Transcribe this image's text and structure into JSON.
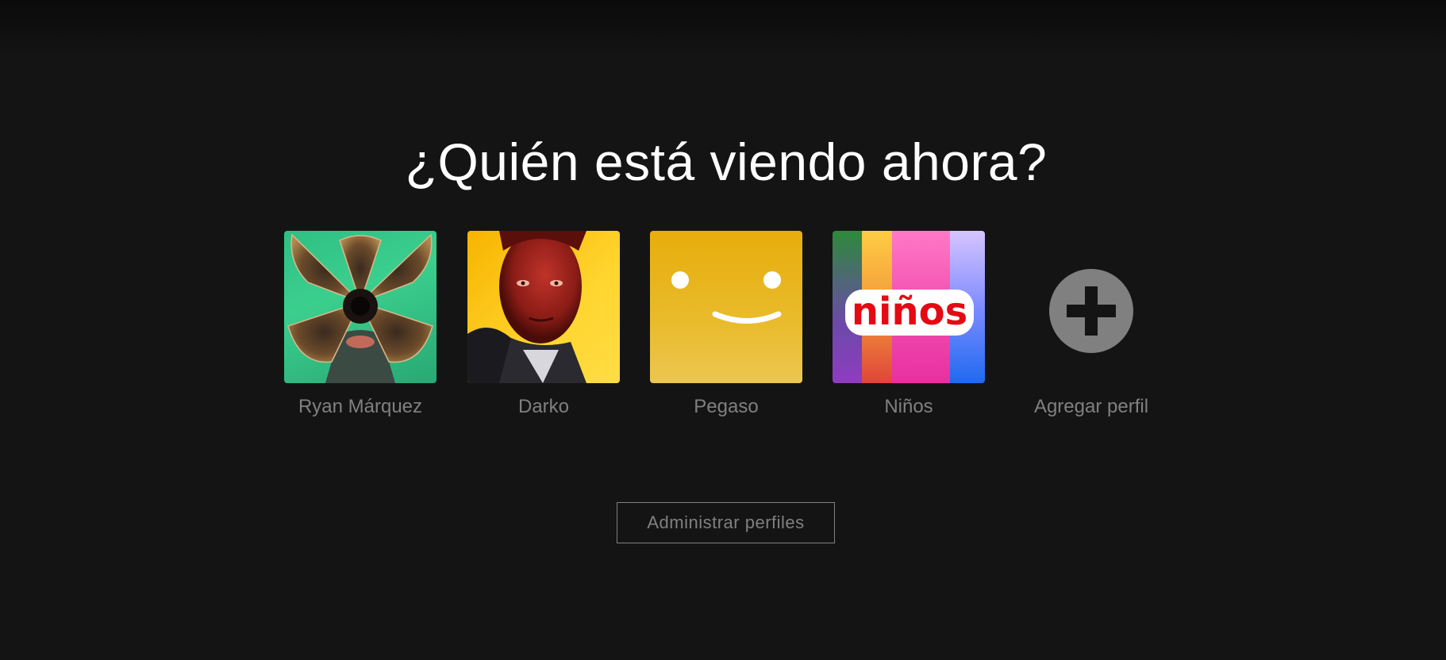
{
  "page": {
    "heading": "¿Quién está viendo ahora?"
  },
  "profiles": [
    {
      "name": "Ryan Márquez",
      "avatar": "creature-avatar"
    },
    {
      "name": "Darko",
      "avatar": "red-face-avatar"
    },
    {
      "name": "Pegaso",
      "avatar": "smiley-avatar"
    },
    {
      "name": "Niños",
      "avatar": "kids-avatar",
      "avatar_text": "niños"
    },
    {
      "name": "Agregar perfil",
      "avatar": "add-icon"
    }
  ],
  "manage": {
    "label": "Administrar perfiles"
  },
  "colors": {
    "background": "#141414",
    "text_muted": "#808080",
    "heading": "#ffffff",
    "kids_red": "#e50914"
  }
}
